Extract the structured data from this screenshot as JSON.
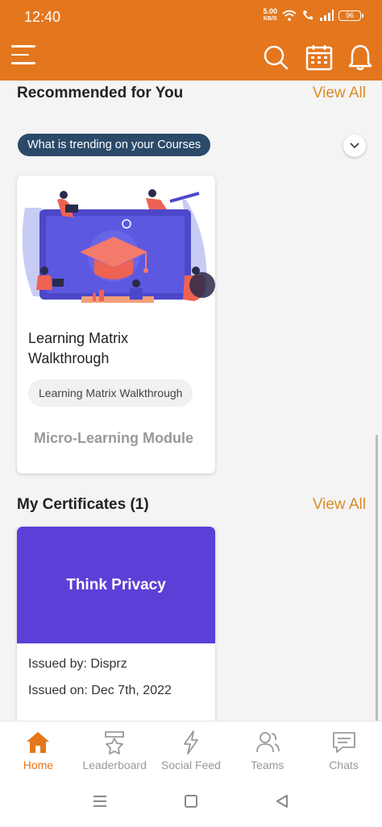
{
  "status_bar": {
    "time": "12:40",
    "net_speed_value": "5.00",
    "net_speed_unit": "KB/S",
    "battery": "96"
  },
  "app_bar": {
    "icons": [
      "menu-icon",
      "search-icon",
      "calendar-icon",
      "bell-icon"
    ],
    "accent_color": "#e4761d"
  },
  "recommended": {
    "title": "Recommended for You",
    "view_all": "View All",
    "filter_pill": "What is trending on your Courses",
    "card": {
      "title": "Learning Matrix Walkthrough",
      "tag": "Learning Matrix Walkthrough",
      "type": "Micro-Learning Module"
    }
  },
  "certificates": {
    "title": "My Certificates (1)",
    "view_all": "View All",
    "card": {
      "banner": "Think Privacy",
      "issued_by": "Issued by: Disprz",
      "issued_on": "Issued on: Dec 7th, 2022"
    }
  },
  "bottom_nav": {
    "items": [
      {
        "label": "Home",
        "icon": "home-icon"
      },
      {
        "label": "Leaderboard",
        "icon": "leaderboard-icon"
      },
      {
        "label": "Social Feed",
        "icon": "social-feed-icon"
      },
      {
        "label": "Teams",
        "icon": "teams-icon"
      },
      {
        "label": "Chats",
        "icon": "chats-icon"
      }
    ],
    "active": "Home"
  }
}
